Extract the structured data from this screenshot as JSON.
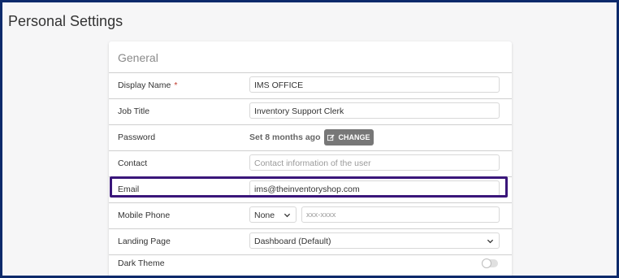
{
  "page": {
    "title": "Personal Settings"
  },
  "section": {
    "title": "General"
  },
  "fields": {
    "display_name": {
      "label": "Display Name",
      "required_mark": "*",
      "value": "IMS OFFICE"
    },
    "job_title": {
      "label": "Job Title",
      "value": "Inventory Support Clerk"
    },
    "password": {
      "label": "Password",
      "status": "Set 8 months ago",
      "button_label": "CHANGE"
    },
    "contact": {
      "label": "Contact",
      "placeholder": "Contact information of the user"
    },
    "email": {
      "label": "Email",
      "value": "ims@theinventoryshop.com"
    },
    "mobile_phone": {
      "label": "Mobile Phone",
      "country_value": "None",
      "placeholder": "xxx-xxxx"
    },
    "landing_page": {
      "label": "Landing Page",
      "value": "Dashboard (Default)"
    },
    "dark_theme": {
      "label": "Dark Theme",
      "enabled": false
    }
  },
  "colors": {
    "highlight": "#3a167a",
    "button": "#777777",
    "frame": "#0d2a6b",
    "required": "#c0392b"
  },
  "icons": {
    "change_button": "edit-icon",
    "dropdown": "chevron-down-icon"
  }
}
